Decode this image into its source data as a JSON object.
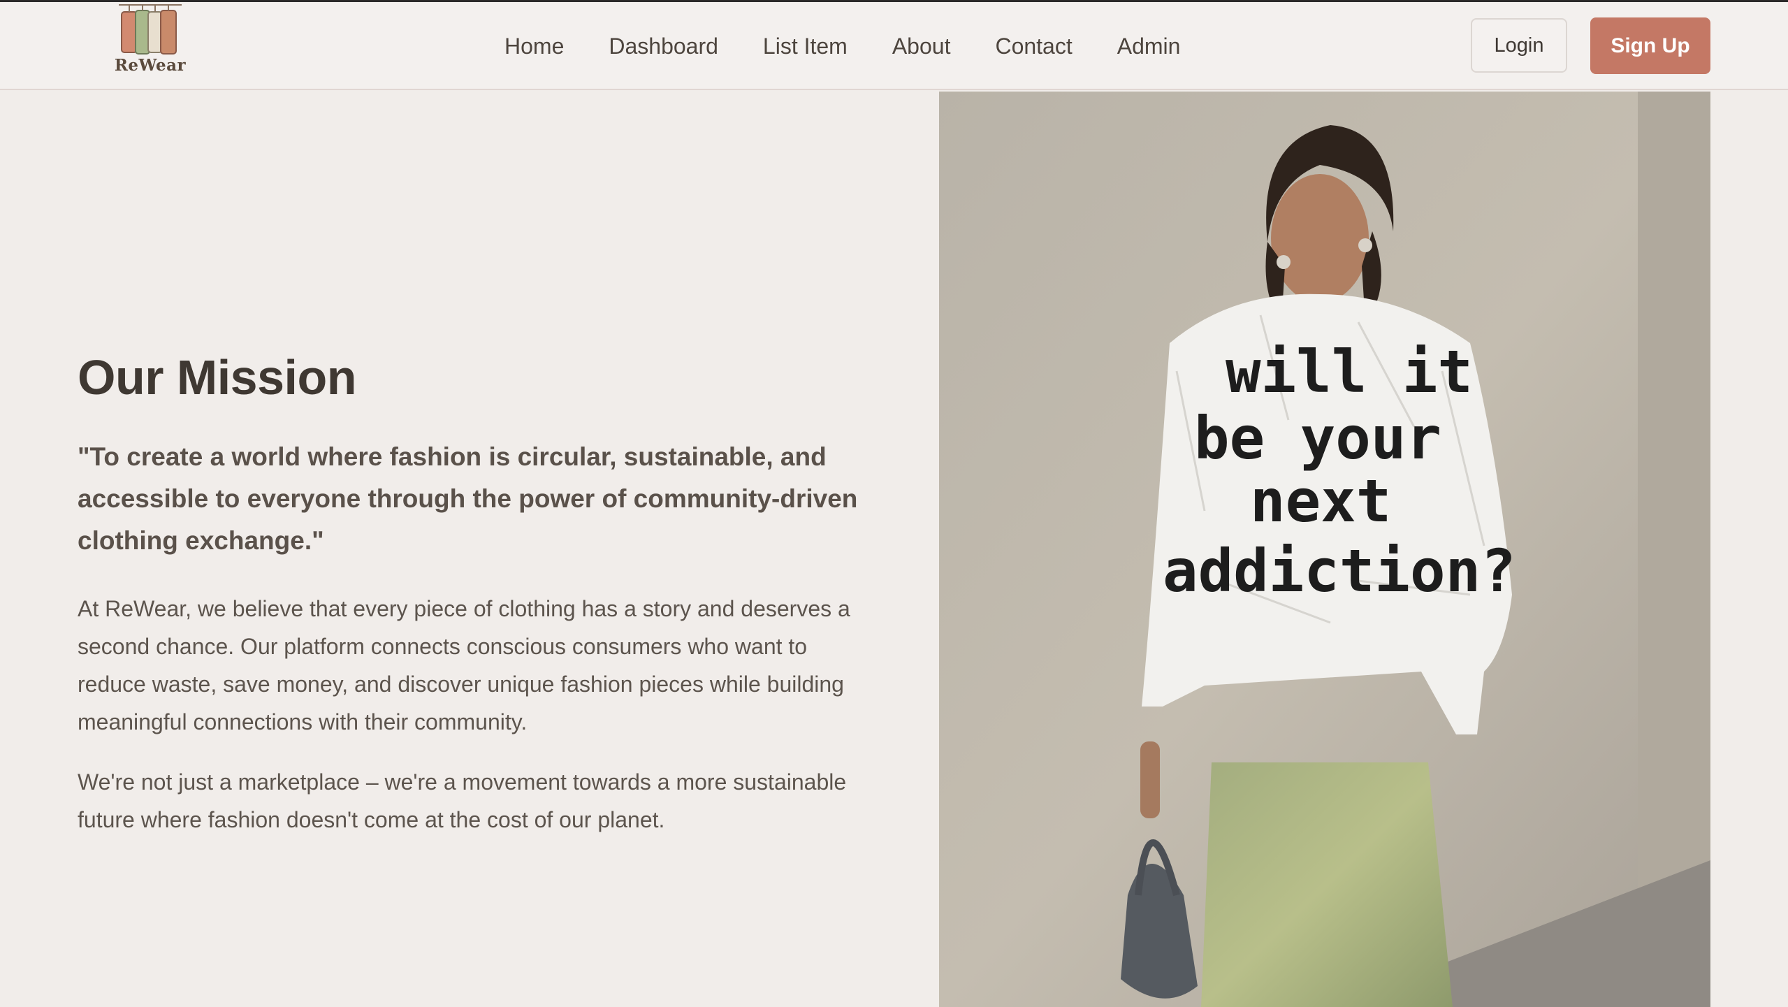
{
  "brand": {
    "name": "ReWear"
  },
  "nav": {
    "items": [
      {
        "label": "Home"
      },
      {
        "label": "Dashboard"
      },
      {
        "label": "List Item"
      },
      {
        "label": "About"
      },
      {
        "label": "Contact"
      },
      {
        "label": "Admin"
      }
    ]
  },
  "auth": {
    "login_label": "Login",
    "signup_label": "Sign Up"
  },
  "mission": {
    "title": "Our Mission",
    "quote": "\"To create a world where fashion is circular, sustainable, and accessible to everyone through the power of community-driven clothing exchange.\"",
    "paragraph1": "At ReWear, we believe that every piece of clothing has a story and deserves a second chance. Our platform connects conscious consumers who want to reduce waste, save money, and discover unique fashion pieces while building meaningful connections with their community.",
    "paragraph2": "We're not just a marketplace – we're a movement towards a more sustainable future where fashion doesn't come at the cost of our planet."
  },
  "hero_image": {
    "text_lines": [
      "will it",
      "be your",
      "next",
      "addiction?"
    ]
  },
  "colors": {
    "accent": "#c47865",
    "background": "#f1edea",
    "text": "#4a423b"
  }
}
